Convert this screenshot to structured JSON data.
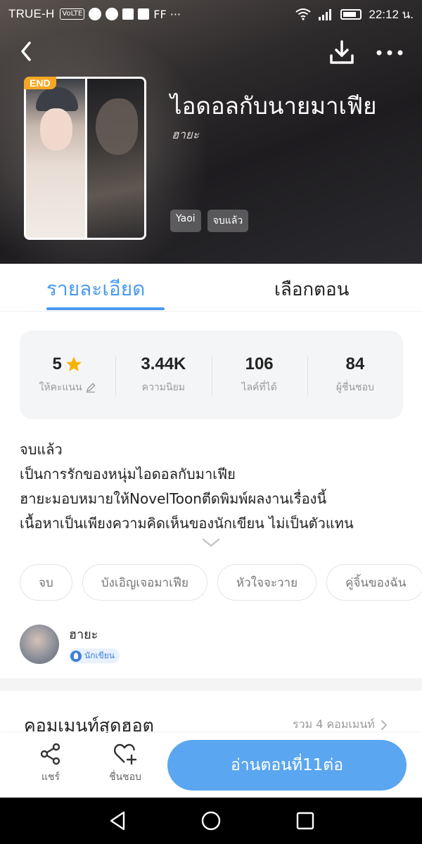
{
  "status_bar": {
    "carrier": "TRUE-H",
    "volte": "VoLTE",
    "extra": "FF ···",
    "time": "22:12 น."
  },
  "header": {
    "title": "ไอดอลกับนายมาเฟีย",
    "author": "ฮายะ",
    "badge": "END",
    "tags": [
      "Yaoi",
      "จบแล้ว"
    ]
  },
  "tabs": {
    "detail": "รายละเอียด",
    "episodes": "เลือกตอน",
    "active": "detail"
  },
  "stats": {
    "rating": {
      "value": "5",
      "label": "ให้คะแนน"
    },
    "popularity": {
      "value": "3.44K",
      "label": "ความนิยม"
    },
    "likes": {
      "value": "106",
      "label": "ไลค์ที่ได้"
    },
    "fans": {
      "value": "84",
      "label": "ผู้ชื่นชอบ"
    }
  },
  "description": {
    "lines": [
      "จบแล้ว",
      "เป็นการรักของหนุ่มไอดอลกับมาเฟีย",
      "ฮายะมอบหมายให้NovelToonตีดพิมพ์ผลงานเรื่องนี้",
      "เนื้อหาเป็นเพียงความคิดเห็นของนักเขียน ไม่เป็นตัวแทน"
    ]
  },
  "keywords": [
    "จบ",
    "บังเอิญเจอมาเฟีย",
    "หัวใจจะวาย",
    "คู่จิ้นของฉัน"
  ],
  "author_card": {
    "name": "ฮายะ",
    "badge": "นักเขียน"
  },
  "comments": {
    "title": "คอมเมนท์สุดฮอต",
    "count_label": "รวม 4 คอมเมนท์"
  },
  "action_bar": {
    "share": "แชร์",
    "favorite": "ชื่นชอบ",
    "read": "อ่านตอนที่11ต่อ"
  },
  "colors": {
    "accent": "#4a9af0",
    "read_button": "#5aa6f0",
    "end_badge": "#f5a623",
    "star": "#f5b400"
  }
}
